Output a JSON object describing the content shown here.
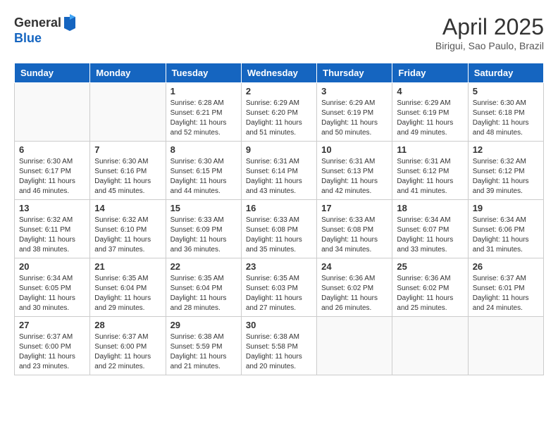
{
  "header": {
    "logo_general": "General",
    "logo_blue": "Blue",
    "month_title": "April 2025",
    "subtitle": "Birigui, Sao Paulo, Brazil"
  },
  "days_of_week": [
    "Sunday",
    "Monday",
    "Tuesday",
    "Wednesday",
    "Thursday",
    "Friday",
    "Saturday"
  ],
  "weeks": [
    [
      {
        "day": "",
        "info": ""
      },
      {
        "day": "",
        "info": ""
      },
      {
        "day": "1",
        "info": "Sunrise: 6:28 AM\nSunset: 6:21 PM\nDaylight: 11 hours and 52 minutes."
      },
      {
        "day": "2",
        "info": "Sunrise: 6:29 AM\nSunset: 6:20 PM\nDaylight: 11 hours and 51 minutes."
      },
      {
        "day": "3",
        "info": "Sunrise: 6:29 AM\nSunset: 6:19 PM\nDaylight: 11 hours and 50 minutes."
      },
      {
        "day": "4",
        "info": "Sunrise: 6:29 AM\nSunset: 6:19 PM\nDaylight: 11 hours and 49 minutes."
      },
      {
        "day": "5",
        "info": "Sunrise: 6:30 AM\nSunset: 6:18 PM\nDaylight: 11 hours and 48 minutes."
      }
    ],
    [
      {
        "day": "6",
        "info": "Sunrise: 6:30 AM\nSunset: 6:17 PM\nDaylight: 11 hours and 46 minutes."
      },
      {
        "day": "7",
        "info": "Sunrise: 6:30 AM\nSunset: 6:16 PM\nDaylight: 11 hours and 45 minutes."
      },
      {
        "day": "8",
        "info": "Sunrise: 6:30 AM\nSunset: 6:15 PM\nDaylight: 11 hours and 44 minutes."
      },
      {
        "day": "9",
        "info": "Sunrise: 6:31 AM\nSunset: 6:14 PM\nDaylight: 11 hours and 43 minutes."
      },
      {
        "day": "10",
        "info": "Sunrise: 6:31 AM\nSunset: 6:13 PM\nDaylight: 11 hours and 42 minutes."
      },
      {
        "day": "11",
        "info": "Sunrise: 6:31 AM\nSunset: 6:12 PM\nDaylight: 11 hours and 41 minutes."
      },
      {
        "day": "12",
        "info": "Sunrise: 6:32 AM\nSunset: 6:12 PM\nDaylight: 11 hours and 39 minutes."
      }
    ],
    [
      {
        "day": "13",
        "info": "Sunrise: 6:32 AM\nSunset: 6:11 PM\nDaylight: 11 hours and 38 minutes."
      },
      {
        "day": "14",
        "info": "Sunrise: 6:32 AM\nSunset: 6:10 PM\nDaylight: 11 hours and 37 minutes."
      },
      {
        "day": "15",
        "info": "Sunrise: 6:33 AM\nSunset: 6:09 PM\nDaylight: 11 hours and 36 minutes."
      },
      {
        "day": "16",
        "info": "Sunrise: 6:33 AM\nSunset: 6:08 PM\nDaylight: 11 hours and 35 minutes."
      },
      {
        "day": "17",
        "info": "Sunrise: 6:33 AM\nSunset: 6:08 PM\nDaylight: 11 hours and 34 minutes."
      },
      {
        "day": "18",
        "info": "Sunrise: 6:34 AM\nSunset: 6:07 PM\nDaylight: 11 hours and 33 minutes."
      },
      {
        "day": "19",
        "info": "Sunrise: 6:34 AM\nSunset: 6:06 PM\nDaylight: 11 hours and 31 minutes."
      }
    ],
    [
      {
        "day": "20",
        "info": "Sunrise: 6:34 AM\nSunset: 6:05 PM\nDaylight: 11 hours and 30 minutes."
      },
      {
        "day": "21",
        "info": "Sunrise: 6:35 AM\nSunset: 6:04 PM\nDaylight: 11 hours and 29 minutes."
      },
      {
        "day": "22",
        "info": "Sunrise: 6:35 AM\nSunset: 6:04 PM\nDaylight: 11 hours and 28 minutes."
      },
      {
        "day": "23",
        "info": "Sunrise: 6:35 AM\nSunset: 6:03 PM\nDaylight: 11 hours and 27 minutes."
      },
      {
        "day": "24",
        "info": "Sunrise: 6:36 AM\nSunset: 6:02 PM\nDaylight: 11 hours and 26 minutes."
      },
      {
        "day": "25",
        "info": "Sunrise: 6:36 AM\nSunset: 6:02 PM\nDaylight: 11 hours and 25 minutes."
      },
      {
        "day": "26",
        "info": "Sunrise: 6:37 AM\nSunset: 6:01 PM\nDaylight: 11 hours and 24 minutes."
      }
    ],
    [
      {
        "day": "27",
        "info": "Sunrise: 6:37 AM\nSunset: 6:00 PM\nDaylight: 11 hours and 23 minutes."
      },
      {
        "day": "28",
        "info": "Sunrise: 6:37 AM\nSunset: 6:00 PM\nDaylight: 11 hours and 22 minutes."
      },
      {
        "day": "29",
        "info": "Sunrise: 6:38 AM\nSunset: 5:59 PM\nDaylight: 11 hours and 21 minutes."
      },
      {
        "day": "30",
        "info": "Sunrise: 6:38 AM\nSunset: 5:58 PM\nDaylight: 11 hours and 20 minutes."
      },
      {
        "day": "",
        "info": ""
      },
      {
        "day": "",
        "info": ""
      },
      {
        "day": "",
        "info": ""
      }
    ]
  ]
}
